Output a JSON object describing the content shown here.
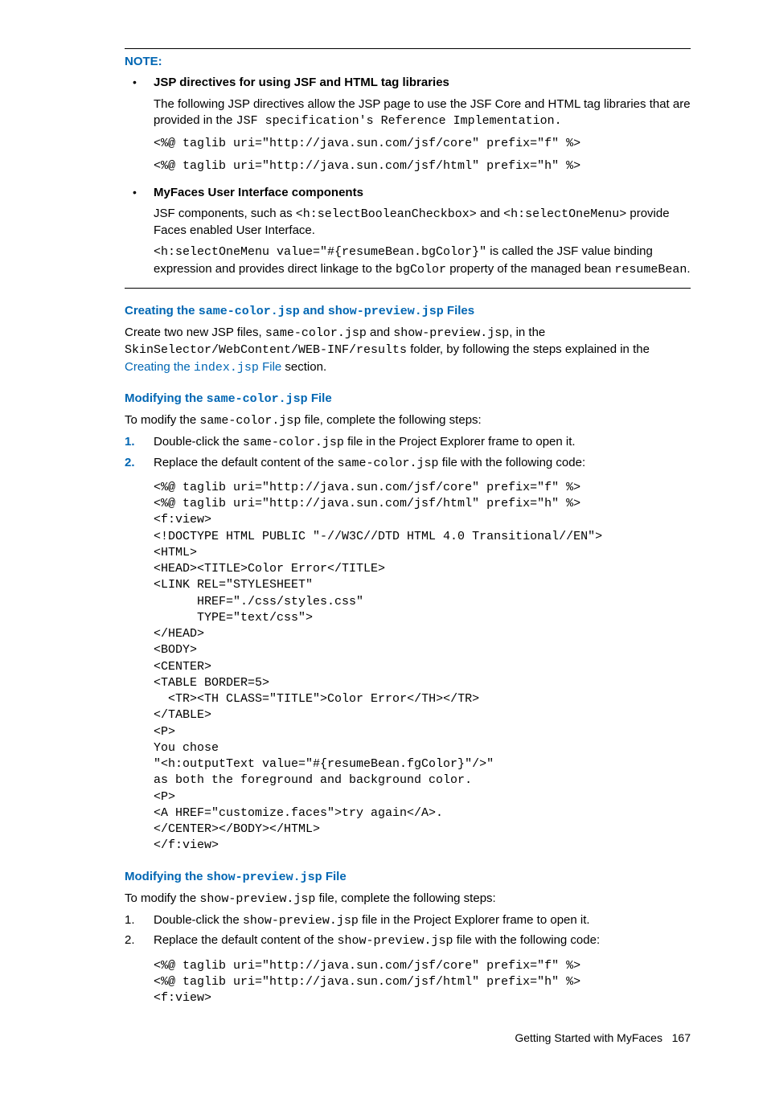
{
  "noteLabel": "NOTE:",
  "bullets": [
    {
      "title": "JSP directives for using JSF and HTML tag libraries",
      "para_pre": "The following JSP directives allow the JSP page to use the JSF Core and HTML tag libraries that are provided in the ",
      "para_mono": "JSF specification's Reference Implementation.",
      "code1": "<%@ taglib uri=\"http://java.sun.com/jsf/core\" prefix=\"f\" %>",
      "code2": "<%@ taglib uri=\"http://java.sun.com/jsf/html\" prefix=\"h\" %>"
    },
    {
      "title": "MyFaces User Interface components",
      "p1_a": "JSF components, such as ",
      "p1_m1": "<h:selectBooleanCheckbox>",
      "p1_b": " and  ",
      "p1_m2": "<h:selectOneMenu>",
      "p1_c": " provide Faces enabled User Interface.",
      "p2_m1": "<h:selectOneMenu value=\"#{resumeBean.bgColor}\"",
      "p2_a": " is called the JSF value binding expression and provides direct linkage to the ",
      "p2_m2": "bgColor",
      "p2_b": " property of the managed bean ",
      "p2_m3": "resumeBean",
      "p2_c": "."
    }
  ],
  "h1": {
    "pre": "Creating the ",
    "m1": "same-color.jsp",
    "mid": " and ",
    "m2": "show-preview.jsp",
    "post": " Files"
  },
  "p_h1_a": "Create two new JSP files, ",
  "p_h1_m1": "same-color.jsp",
  "p_h1_b": " and ",
  "p_h1_m2": "show-preview.jsp",
  "p_h1_c": ", in the ",
  "p_h1_m3": "SkinSelector/WebContent/WEB-INF/results",
  "p_h1_d": " folder, by following the steps explained in the ",
  "p_h1_link_a": "Creating the ",
  "p_h1_link_m": "index.jsp",
  "p_h1_link_b": " File",
  "p_h1_e": " section.",
  "h2": {
    "pre": "Modifying the ",
    "m": "same-color.jsp",
    "post": " File"
  },
  "p_h2_a": "To modify the ",
  "p_h2_m": "same-color.jsp",
  "p_h2_b": " file, complete the following steps:",
  "ol1": {
    "n1": "1.",
    "i1a": "Double-click the ",
    "i1m": "same-color.jsp",
    "i1b": " file in the Project Explorer frame to open it.",
    "n2": "2.",
    "i2a": "Replace the default content of the ",
    "i2m": "same-color.jsp",
    "i2b": " file with the following code:"
  },
  "code_block1": "<%@ taglib uri=\"http://java.sun.com/jsf/core\" prefix=\"f\" %>\n<%@ taglib uri=\"http://java.sun.com/jsf/html\" prefix=\"h\" %>\n<f:view>\n<!DOCTYPE HTML PUBLIC \"-//W3C//DTD HTML 4.0 Transitional//EN\">\n<HTML>\n<HEAD><TITLE>Color Error</TITLE>\n<LINK REL=\"STYLESHEET\"\n      HREF=\"./css/styles.css\"\n      TYPE=\"text/css\">\n</HEAD>\n<BODY>\n<CENTER>\n<TABLE BORDER=5>\n  <TR><TH CLASS=\"TITLE\">Color Error</TH></TR>\n</TABLE>\n<P>\nYou chose\n\"<h:outputText value=\"#{resumeBean.fgColor}\"/>\"\nas both the foreground and background color.\n<P>\n<A HREF=\"customize.faces\">try again</A>.\n</CENTER></BODY></HTML>\n</f:view>",
  "h3": {
    "pre": "Modifying the ",
    "m": "show-preview.jsp",
    "post": " File"
  },
  "p_h3_a": "To modify the ",
  "p_h3_m": "show-preview.jsp",
  "p_h3_b": " file, complete the following steps:",
  "ol2": {
    "n1": "1.",
    "i1a": "Double-click the ",
    "i1m": "show-preview.jsp",
    "i1b": " file in the Project Explorer frame to open it.",
    "n2": "2.",
    "i2a": "Replace the default content of the ",
    "i2m": "show-preview.jsp",
    "i2b": " file with the following code:"
  },
  "code_block2": "<%@ taglib uri=\"http://java.sun.com/jsf/core\" prefix=\"f\" %>\n<%@ taglib uri=\"http://java.sun.com/jsf/html\" prefix=\"h\" %>\n<f:view>",
  "footer_text": "Getting Started with MyFaces",
  "footer_page": "167"
}
